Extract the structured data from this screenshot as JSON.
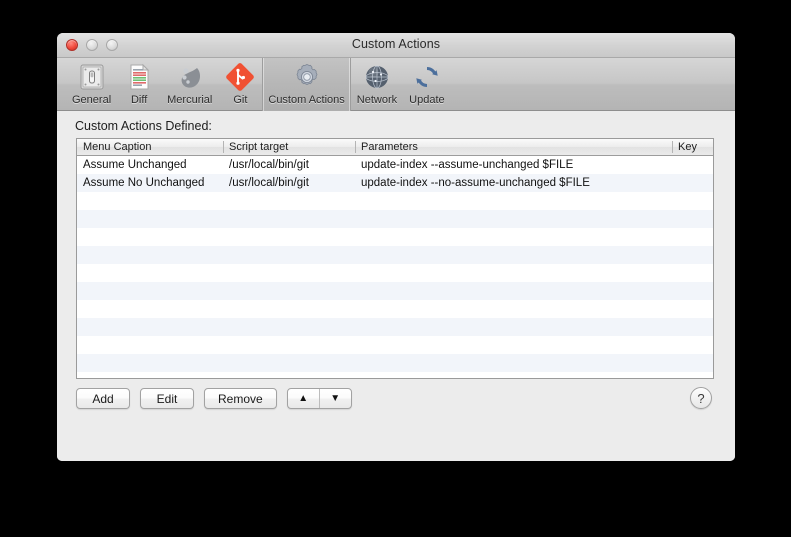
{
  "window": {
    "title": "Custom Actions",
    "traffic_lights": [
      {
        "name": "close",
        "color": "#f0483a",
        "enabled": true
      },
      {
        "name": "minimize",
        "color": "#d9d9d9",
        "enabled": false
      },
      {
        "name": "zoom",
        "color": "#d9d9d9",
        "enabled": false
      }
    ]
  },
  "toolbar": {
    "items": [
      {
        "label": "General",
        "icon": "switch-panel-icon",
        "selected": false
      },
      {
        "label": "Diff",
        "icon": "document-diff-icon",
        "selected": false
      },
      {
        "label": "Mercurial",
        "icon": "mercurial-droplet-icon",
        "selected": false
      },
      {
        "label": "Git",
        "icon": "git-diamond-icon",
        "selected": false
      },
      {
        "label": "Custom Actions",
        "icon": "gear-icon",
        "selected": true
      },
      {
        "label": "Network",
        "icon": "globe-icon",
        "selected": false
      },
      {
        "label": "Update",
        "icon": "refresh-arrows-icon",
        "selected": false
      }
    ]
  },
  "content": {
    "section_label": "Custom Actions Defined:",
    "table": {
      "columns": [
        {
          "key": "caption",
          "label": "Menu Caption"
        },
        {
          "key": "target",
          "label": "Script target"
        },
        {
          "key": "params",
          "label": "Parameters"
        },
        {
          "key": "key",
          "label": "Key"
        }
      ],
      "rows": [
        {
          "caption": "Assume Unchanged",
          "target": "/usr/local/bin/git",
          "params": "update-index --assume-unchanged $FILE",
          "key": ""
        },
        {
          "caption": "Assume No Unchanged",
          "target": "/usr/local/bin/git",
          "params": "update-index --no-assume-unchanged $FILE",
          "key": ""
        }
      ],
      "empty_row_count": 11
    },
    "buttons": {
      "add": "Add",
      "edit": "Edit",
      "remove": "Remove",
      "move_up": "▲",
      "move_down": "▼",
      "help": "?"
    }
  }
}
